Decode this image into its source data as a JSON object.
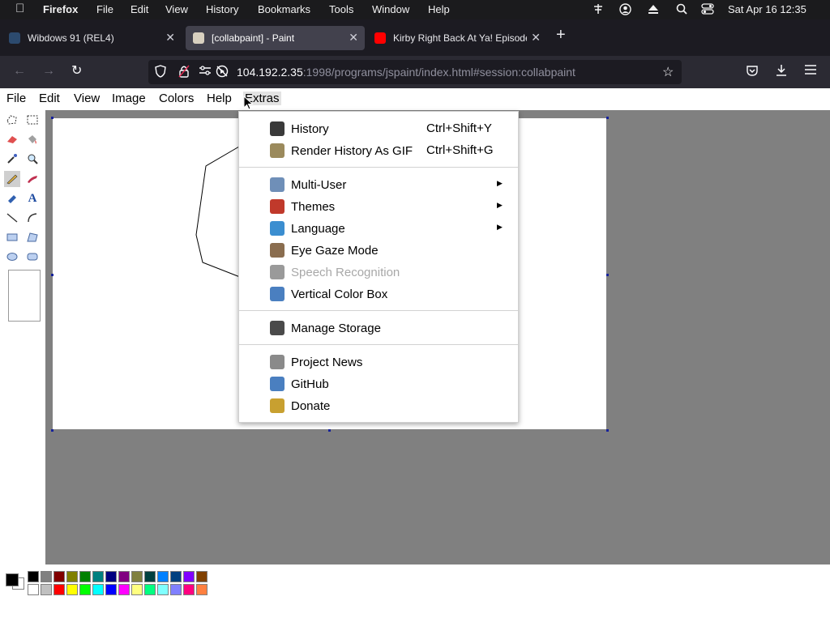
{
  "mac_menubar": {
    "app_name": "Firefox",
    "items": [
      "File",
      "Edit",
      "View",
      "History",
      "Bookmarks",
      "Tools",
      "Window",
      "Help"
    ],
    "clock": "Sat Apr 16  12:35"
  },
  "browser": {
    "tabs": [
      {
        "title": "Wibdows 91 (REL4)",
        "active": false
      },
      {
        "title": "[collabpaint] - Paint",
        "active": true
      },
      {
        "title": "Kirby Right Back At Ya! Episode",
        "active": false
      }
    ],
    "new_tab": "+",
    "url_host": "104.192.2.35",
    "url_rest": ":1998/programs/jspaint/index.html#session:collabpaint"
  },
  "paint": {
    "menus": [
      "File",
      "Edit",
      "View",
      "Image",
      "Colors",
      "Help",
      "Extras"
    ],
    "open_menu": "Extras",
    "palette_primary": "#000000",
    "palette_secondary": "#ffffff",
    "palette_top": [
      "#000000",
      "#808080",
      "#800000",
      "#808000",
      "#008000",
      "#008080",
      "#000080",
      "#800080",
      "#808040",
      "#004040",
      "#0080ff",
      "#004080",
      "#8000ff",
      "#804000"
    ],
    "palette_bottom": [
      "#ffffff",
      "#c0c0c0",
      "#ff0000",
      "#ffff00",
      "#00ff00",
      "#00ffff",
      "#0000ff",
      "#ff00ff",
      "#ffff80",
      "#00ff80",
      "#80ffff",
      "#8080ff",
      "#ff0080",
      "#ff8040"
    ]
  },
  "extras_menu": {
    "items": [
      {
        "label": "History",
        "shortcut": "Ctrl+Shift+Y",
        "icon": "history-icon",
        "color": "#3a3a3a"
      },
      {
        "label": "Render History As GIF",
        "shortcut": "Ctrl+Shift+G",
        "icon": "film-icon",
        "color": "#9b8a5c"
      },
      {
        "label": "Multi-User",
        "icon": "users-icon",
        "color": "#6f8fb8",
        "submenu": true
      },
      {
        "label": "Themes",
        "icon": "themes-icon",
        "color": "#c0392b",
        "submenu": true
      },
      {
        "label": "Language",
        "icon": "globe-icon",
        "color": "#3b8ed0",
        "submenu": true
      },
      {
        "label": "Eye Gaze Mode",
        "icon": "eye-icon",
        "color": "#8a6d4f"
      },
      {
        "label": "Speech Recognition",
        "icon": "microphone-icon",
        "color": "#9a9a9a",
        "disabled": true
      },
      {
        "label": "Vertical Color Box",
        "icon": "vertical-arrows-icon",
        "color": "#4a7fc0"
      },
      {
        "label": "Manage Storage",
        "icon": "storage-icon",
        "color": "#4a4a4a"
      },
      {
        "label": "Project News",
        "icon": "megaphone-icon",
        "color": "#8a8a8a"
      },
      {
        "label": "GitHub",
        "icon": "info-icon",
        "color": "#4a7fc0"
      },
      {
        "label": "Donate",
        "icon": "money-icon",
        "color": "#c8a030"
      }
    ]
  }
}
